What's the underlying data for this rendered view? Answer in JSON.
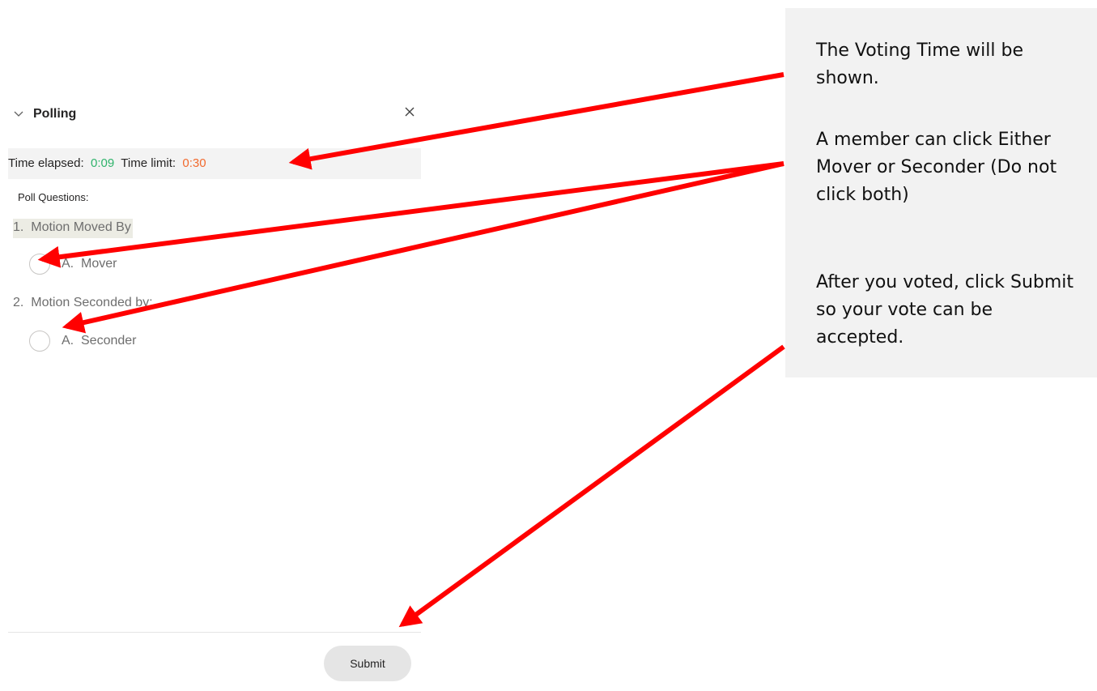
{
  "panel": {
    "title": "Polling",
    "time": {
      "elapsed_label": "Time elapsed:",
      "elapsed_value": "0:09",
      "limit_label": "Time limit:",
      "limit_value": "0:30"
    },
    "poll_questions_label": "Poll Questions:",
    "questions": [
      {
        "text": "1.  Motion Moved By",
        "options": [
          {
            "text": "A.  Mover"
          }
        ]
      },
      {
        "text": "2.  Motion Seconded by:",
        "options": [
          {
            "text": "A.  Seconder"
          }
        ]
      }
    ],
    "submit_label": "Submit"
  },
  "callout": {
    "paragraphs": [
      "The Voting Time will be shown.",
      "A member can click Either Mover or Seconder (Do not click both)",
      "After you voted, click Submit so your vote can be accepted."
    ]
  },
  "colors": {
    "elapsed": "#2fb36b",
    "limit": "#f26a2e",
    "arrow": "#ff0000",
    "callout_bg": "#f2f2f2"
  }
}
